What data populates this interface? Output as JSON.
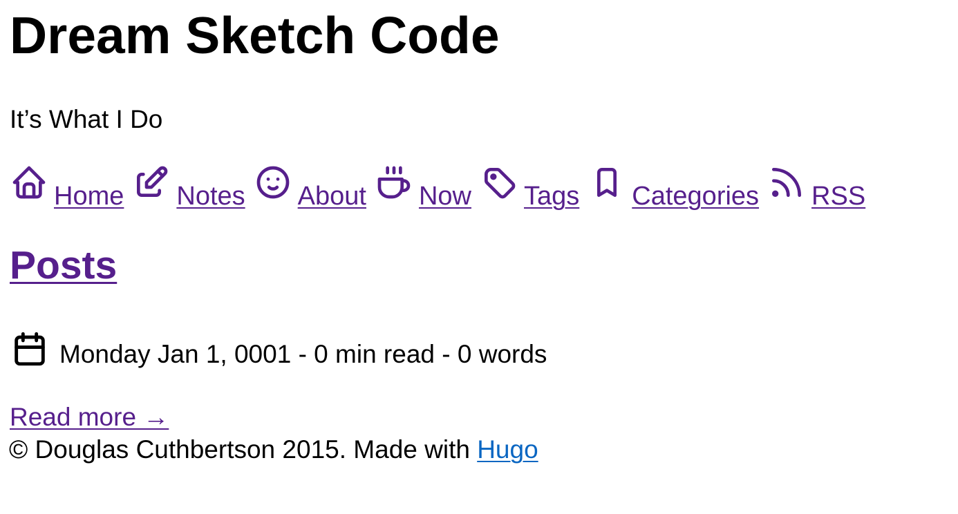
{
  "site": {
    "title": "Dream Sketch Code",
    "tagline": "It’s What I Do"
  },
  "nav": {
    "items": [
      {
        "label": "Home",
        "icon": "home-icon"
      },
      {
        "label": "Notes",
        "icon": "edit-icon"
      },
      {
        "label": "About",
        "icon": "smile-icon"
      },
      {
        "label": "Now",
        "icon": "coffee-icon"
      },
      {
        "label": "Tags",
        "icon": "tag-icon"
      },
      {
        "label": "Categories",
        "icon": "bookmark-icon"
      },
      {
        "label": "RSS",
        "icon": "rss-icon"
      }
    ]
  },
  "main": {
    "heading": "Posts",
    "post": {
      "meta": "Monday Jan 1, 0001 - 0 min read - 0 words",
      "meta_icon": "calendar-icon",
      "read_more": "Read more →"
    }
  },
  "footer": {
    "copyright": "© Douglas Cuthbertson 2015. Made with ",
    "link_label": "Hugo"
  },
  "colors": {
    "link": "#561f8c",
    "footer_link": "#0a66c2",
    "text": "#000000",
    "background": "#ffffff"
  }
}
